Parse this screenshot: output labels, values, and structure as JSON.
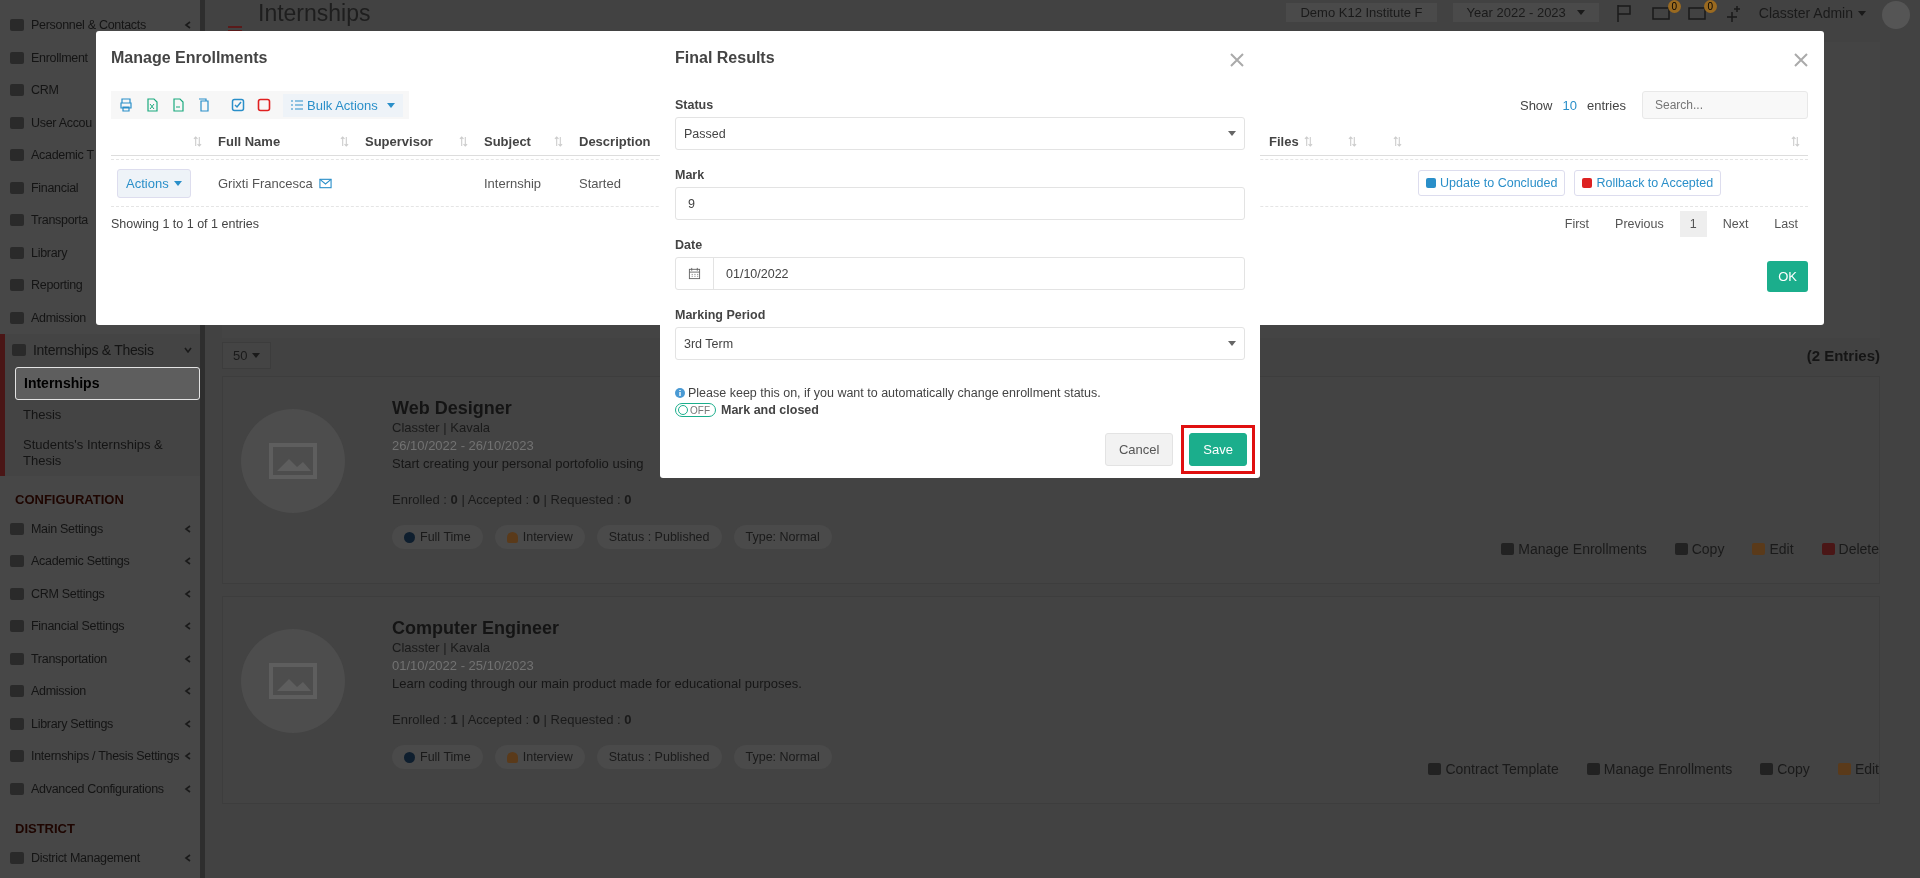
{
  "header": {
    "title": "Internships",
    "institute": "Demo K12 Institute F",
    "year": "Year 2022 - 2023",
    "badges": [
      "0",
      "0"
    ],
    "user": "Classter Admin"
  },
  "sidebar": {
    "items": [
      {
        "label": "Personnel & Contacts",
        "selected": false,
        "expanded": false
      },
      {
        "label": "Enrollment",
        "selected": false
      },
      {
        "label": "CRM",
        "selected": false
      },
      {
        "label": "User Accou",
        "selected": false
      },
      {
        "label": "Academic T",
        "selected": false
      },
      {
        "label": "Financial",
        "selected": false
      },
      {
        "label": "Transporta",
        "selected": false
      },
      {
        "label": "Library",
        "selected": false
      },
      {
        "label": "Reporting",
        "selected": false
      },
      {
        "label": "Admission",
        "selected": false
      },
      {
        "label": "Internships & Thesis",
        "selected": false,
        "expanded": true,
        "children": [
          {
            "label": "Internships",
            "selected": true
          },
          {
            "label": "Thesis",
            "selected": false
          },
          {
            "label": "Students's Internships & Thesis",
            "selected": false
          }
        ]
      }
    ],
    "sections": [
      {
        "title": "CONFIGURATION",
        "items": [
          {
            "label": "Main Settings",
            "selected": false,
            "expanded": false
          },
          {
            "label": "Academic Settings",
            "selected": false,
            "expanded": false
          },
          {
            "label": "CRM Settings",
            "selected": false,
            "expanded": false
          },
          {
            "label": "Financial Settings",
            "selected": false,
            "expanded": false
          },
          {
            "label": "Transportation",
            "selected": false,
            "expanded": false
          },
          {
            "label": "Admission",
            "selected": false,
            "expanded": false
          },
          {
            "label": "Library Settings",
            "selected": false,
            "expanded": false
          },
          {
            "label": "Internships / Thesis Settings",
            "selected": false,
            "expanded": false
          },
          {
            "label": "Advanced Configurations",
            "selected": false,
            "expanded": false
          }
        ]
      },
      {
        "title": "DISTRICT",
        "items": [
          {
            "label": "District Management",
            "selected": false,
            "expanded": false
          }
        ]
      }
    ]
  },
  "listing": {
    "page_size": "50",
    "count": "(2 Entries)",
    "cards": [
      {
        "title": "Web Designer",
        "organization": "Classter | Kavala",
        "dates": "26/10/2022 - 26/10/2023",
        "description": "Start creating your personal portofolio using",
        "counts": "Enrolled : **0** | Accepted : **0** | Requested : **0**",
        "tags": [
          {
            "kind": "time",
            "label": "Full Time"
          },
          {
            "kind": "interview",
            "label": "Interview"
          },
          {
            "kind": "plain",
            "label": "Status : Published"
          },
          {
            "kind": "plain",
            "label": "Type: Normal"
          }
        ],
        "actions": [
          {
            "kind": "enrollments",
            "label": "Manage Enrollments"
          },
          {
            "kind": "copy",
            "label": "Copy"
          },
          {
            "kind": "edit",
            "label": "Edit"
          },
          {
            "kind": "delete",
            "label": "Delete"
          }
        ]
      },
      {
        "title": "Computer Engineer",
        "organization": "Classter | Kavala",
        "dates": "01/10/2022 - 25/10/2023",
        "description": "Learn coding through our main product made for educational purposes.",
        "counts": "Enrolled : **1** | Accepted : **0** | Requested : **0**",
        "tags": [
          {
            "kind": "time",
            "label": "Full Time"
          },
          {
            "kind": "interview",
            "label": "Interview"
          },
          {
            "kind": "plain",
            "label": "Status : Published"
          },
          {
            "kind": "plain",
            "label": "Type: Normal"
          }
        ],
        "actions": [
          {
            "kind": "contract",
            "label": "Contract Template"
          },
          {
            "kind": "enrollments",
            "label": "Manage Enrollments"
          },
          {
            "kind": "copy",
            "label": "Copy"
          },
          {
            "kind": "edit",
            "label": "Edit"
          }
        ]
      }
    ]
  },
  "enrollments_dialog": {
    "title": "Manage Enrollments",
    "bulk_actions": "Bulk Actions",
    "length": {
      "prefix": "Show",
      "value": "10",
      "suffix": "entries"
    },
    "search": {
      "placeholder": "Search..."
    },
    "columns": [
      {},
      {
        "label": "Full Name"
      },
      {
        "label": "Supervisor"
      },
      {
        "label": "Subject"
      },
      {
        "label": "Description"
      },
      {
        "label": "Files"
      },
      {},
      {},
      {}
    ],
    "rows": [
      {
        "action": "Actions",
        "full_name": "Grixti Francesca",
        "subject": "Internship",
        "description": "Started",
        "buttons": [
          {
            "kind": "conclude",
            "label": "Update to Concluded"
          },
          {
            "kind": "rollback",
            "label": "Rollback to Accepted"
          }
        ]
      }
    ],
    "info": "Showing 1 to 1 of 1 entries",
    "pagination": [
      {
        "label": "First",
        "selected": false
      },
      {
        "label": "Previous",
        "selected": false
      },
      {
        "label": "1",
        "selected": true
      },
      {
        "label": "Next",
        "selected": false
      },
      {
        "label": "Last",
        "selected": false
      }
    ],
    "ok": "OK"
  },
  "results_dialog": {
    "title": "Final Results",
    "fields": [
      {
        "kind": "select",
        "label": "Status",
        "value": "Passed"
      },
      {
        "kind": "text",
        "label": "Mark",
        "value": "9"
      },
      {
        "kind": "date",
        "label": "Date",
        "value": "01/10/2022"
      },
      {
        "kind": "select",
        "label": "Marking Period",
        "value": "3rd Term"
      }
    ],
    "note": "Please keep this on, if you want to automatically change enrollment status.",
    "toggle": {
      "on": false,
      "state_text": "OFF",
      "label": "Mark and closed"
    },
    "buttons": [
      {
        "kind": "cancel",
        "label": "Cancel",
        "highlighted": false
      },
      {
        "kind": "save",
        "label": "Save",
        "highlighted": true
      }
    ]
  }
}
